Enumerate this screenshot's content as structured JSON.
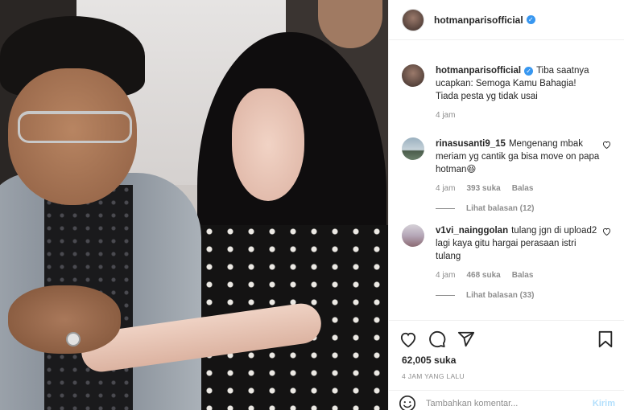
{
  "post": {
    "username": "hotmanparisofficial",
    "verified": true
  },
  "comments": [
    {
      "username": "hotmanparisofficial",
      "text": "Tiba saatnya ucapkan: Semoga Kamu Bahagia! Tiada pesta yg tidak usai",
      "time": "4 jam",
      "is_caption": true
    },
    {
      "username": "rinasusanti9_15",
      "text": "Mengenang mbak meriam yg cantik ga bisa move on papa hotman😆",
      "time": "4 jam",
      "likes": "393 suka",
      "reply": "Balas",
      "view_replies": "Lihat balasan (12)"
    },
    {
      "username": "v1vi_nainggolan",
      "text": "tulang jgn di upload2 lagi kaya gitu hargai perasaan istri tulang",
      "time": "4 jam",
      "likes": "468 suka",
      "reply": "Balas",
      "view_replies": "Lihat balasan (33)"
    }
  ],
  "actions": {
    "like_count": "62,005 suka",
    "time_ago": "4 JAM YANG LALU"
  },
  "add_comment": {
    "placeholder": "Tambahkan komentar...",
    "post_label": "Kirim"
  },
  "colors": {
    "verified": "#3897f0",
    "muted": "#8e8e8e",
    "post_disabled": "#b2dffc"
  }
}
